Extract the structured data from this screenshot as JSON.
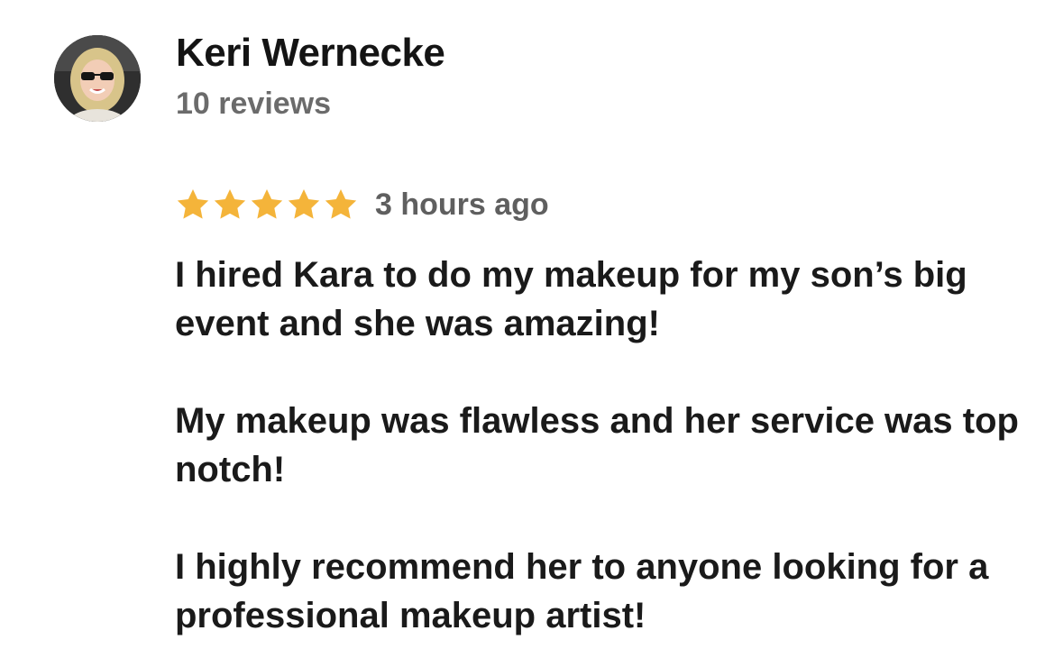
{
  "review": {
    "author": {
      "name": "Keri Wernecke",
      "review_count": "10 reviews",
      "avatar_icon": "profile-photo"
    },
    "rating": {
      "stars": 5,
      "max_stars": 5,
      "star_color": "#F4B43A"
    },
    "timestamp": "3 hours ago",
    "paragraphs": [
      "I hired Kara to do my makeup for my son’s big event and she was amazing!",
      "My makeup was flawless and her service was top notch!",
      "I highly recommend her to anyone looking for a professional makeup artist!"
    ]
  }
}
